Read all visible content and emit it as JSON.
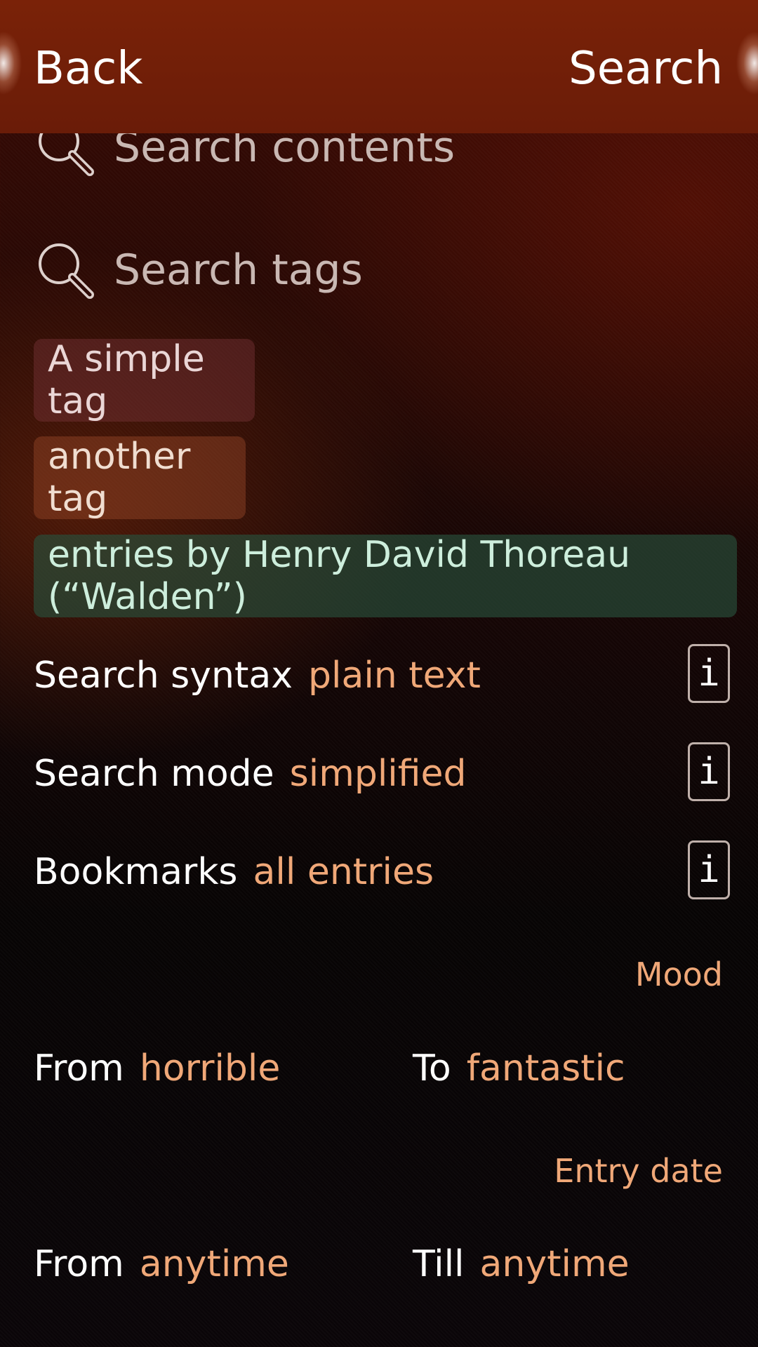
{
  "header": {
    "back_label": "Back",
    "accept_label": "Search"
  },
  "search": {
    "contents_placeholder": "Search contents",
    "tags_placeholder": "Search tags"
  },
  "tags": [
    {
      "label": "A simple tag"
    },
    {
      "label": "another tag"
    },
    {
      "label": "entries by Henry David Thoreau (“Walden”)"
    }
  ],
  "options": {
    "syntax": {
      "label": "Search syntax",
      "value": "plain text",
      "info_icon": "i"
    },
    "mode": {
      "label": "Search mode",
      "value": "simplified",
      "info_icon": "i"
    },
    "bookmarks": {
      "label": "Bookmarks",
      "value": "all entries",
      "info_icon": "i"
    }
  },
  "mood": {
    "section_label": "Mood",
    "from_label": "From",
    "from_value": "horrible",
    "to_label": "To",
    "to_value": "fantastic"
  },
  "entry_date": {
    "section_label": "Entry date",
    "from_label": "From",
    "from_value": "anytime",
    "till_label": "Till",
    "till_value": "anytime"
  },
  "colors": {
    "header_bg": "#7a2208",
    "accent": "#f0a878",
    "tag_highlight": "#28503c"
  },
  "icons": [
    "search-icon",
    "info-icon"
  ]
}
